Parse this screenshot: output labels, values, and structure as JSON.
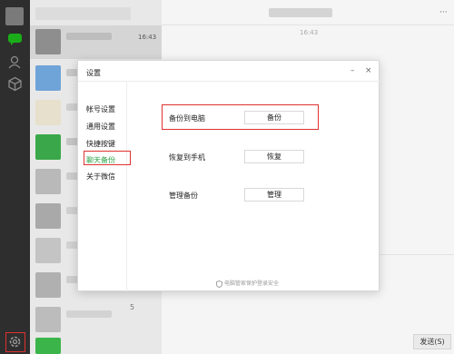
{
  "chat_list": {
    "time": "16:43",
    "bottom_digit": "5"
  },
  "main": {
    "time": "16:43",
    "send_label": "发送(S)"
  },
  "dialog": {
    "title": "设置",
    "nav": [
      "帐号设置",
      "通用设置",
      "快捷按键",
      "聊天备份",
      "关于微信"
    ],
    "active_nav_index": 3,
    "rows": [
      {
        "label": "备份到电脑",
        "button": "备份"
      },
      {
        "label": "恢复到手机",
        "button": "恢复"
      },
      {
        "label": "管理备份",
        "button": "管理"
      }
    ],
    "footer": "电脑管家保护登录安全"
  },
  "colors": {
    "accent_green": "#2ba245",
    "highlight_red": "#e03030",
    "sidebar_bg": "#2e2e2e"
  },
  "icons": [
    "chat-icon",
    "contacts-icon",
    "favorites-icon",
    "settings-icon",
    "emoji-icon",
    "minimize-icon",
    "close-icon",
    "shield-icon"
  ]
}
